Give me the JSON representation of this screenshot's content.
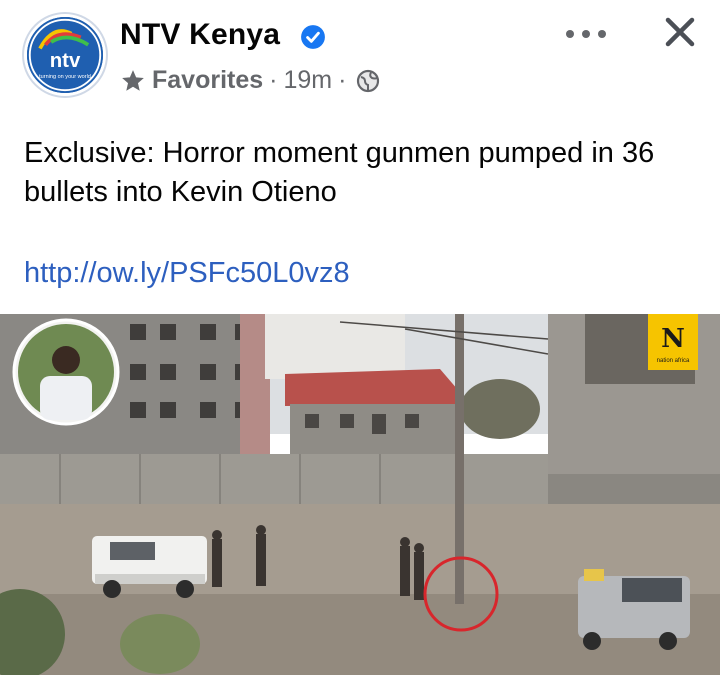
{
  "post": {
    "page_name": "NTV Kenya",
    "avatar_logo_text": "ntv",
    "avatar_tagline": "turning on your world",
    "audience": "Favorites",
    "time": "19m",
    "caption": "Exclusive: Horror moment gunmen pumped in 36 bullets into Kevin Otieno",
    "link": "http://ow.ly/PSFc50L0vz8"
  },
  "image": {
    "watermark_letter": "N",
    "watermark_text": "nation africa"
  },
  "icons": {
    "verified": "verified-badge-icon",
    "audience": "star-icon",
    "privacy": "globe-icon",
    "more": "more-options-icon",
    "close": "close-icon"
  },
  "colors": {
    "brand_blue": "#1f5fb0",
    "verified_blue": "#1877f2",
    "link": "#2d5fbf",
    "secondary_text": "#65676b",
    "highlight_circle": "#d8262c",
    "watermark_bg": "#f6c400"
  }
}
